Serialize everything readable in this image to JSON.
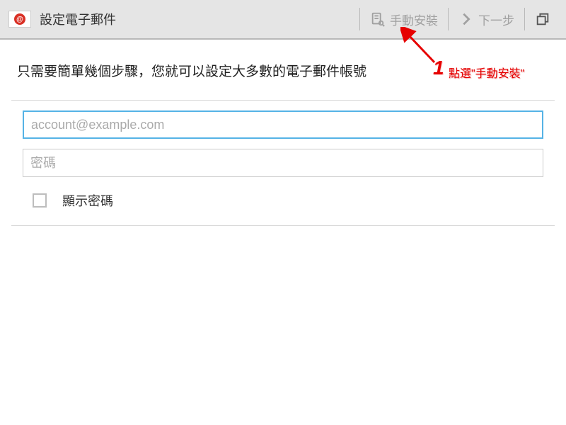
{
  "header": {
    "title": "設定電子郵件",
    "manual_setup_label": "手動安裝",
    "next_label": "下一步",
    "app_icon_glyph": "@"
  },
  "main": {
    "instruction": "只需要簡單幾個步驟，您就可以設定大多數的電子郵件帳號",
    "email_placeholder": "account@example.com",
    "email_value": "",
    "password_placeholder": "密碼",
    "password_value": "",
    "show_password_label": "顯示密碼"
  },
  "annotation": {
    "number": "1",
    "text": "點選\"手動安裝\""
  }
}
